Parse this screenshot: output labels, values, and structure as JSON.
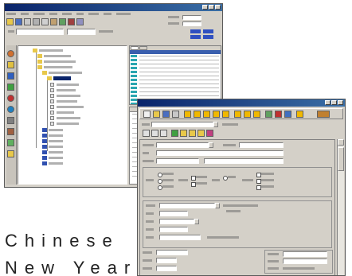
{
  "back_window": {
    "title": "",
    "menu_items": [
      "",
      "",
      "",
      "",
      "",
      "",
      "",
      "",
      ""
    ],
    "toolbar_icons": [
      "folder-icon",
      "save-icon",
      "print-icon",
      "cut-icon",
      "copy-icon",
      "paste-icon",
      "find-icon",
      "help-icon"
    ],
    "sidebar_icons": [
      "user-icon",
      "mail-icon",
      "calendar-icon",
      "chart-icon",
      "settings-icon",
      "globe-icon",
      "phone-icon",
      "book-icon"
    ],
    "tree_folder_color": "#e8c84a",
    "list_highlight_color": "#2aa6b0"
  },
  "front_window": {
    "title": "",
    "toolbar_icons": [
      "new-icon",
      "open-icon",
      "save-icon",
      "print-icon",
      "cut-icon",
      "copy-icon",
      "paste-icon",
      "undo-icon",
      "find-icon",
      "chart-icon",
      "mail-icon",
      "help-icon"
    ],
    "accent_color": "#f0b800"
  },
  "caption": {
    "line1": "Chinese",
    "line2": "New Year"
  }
}
